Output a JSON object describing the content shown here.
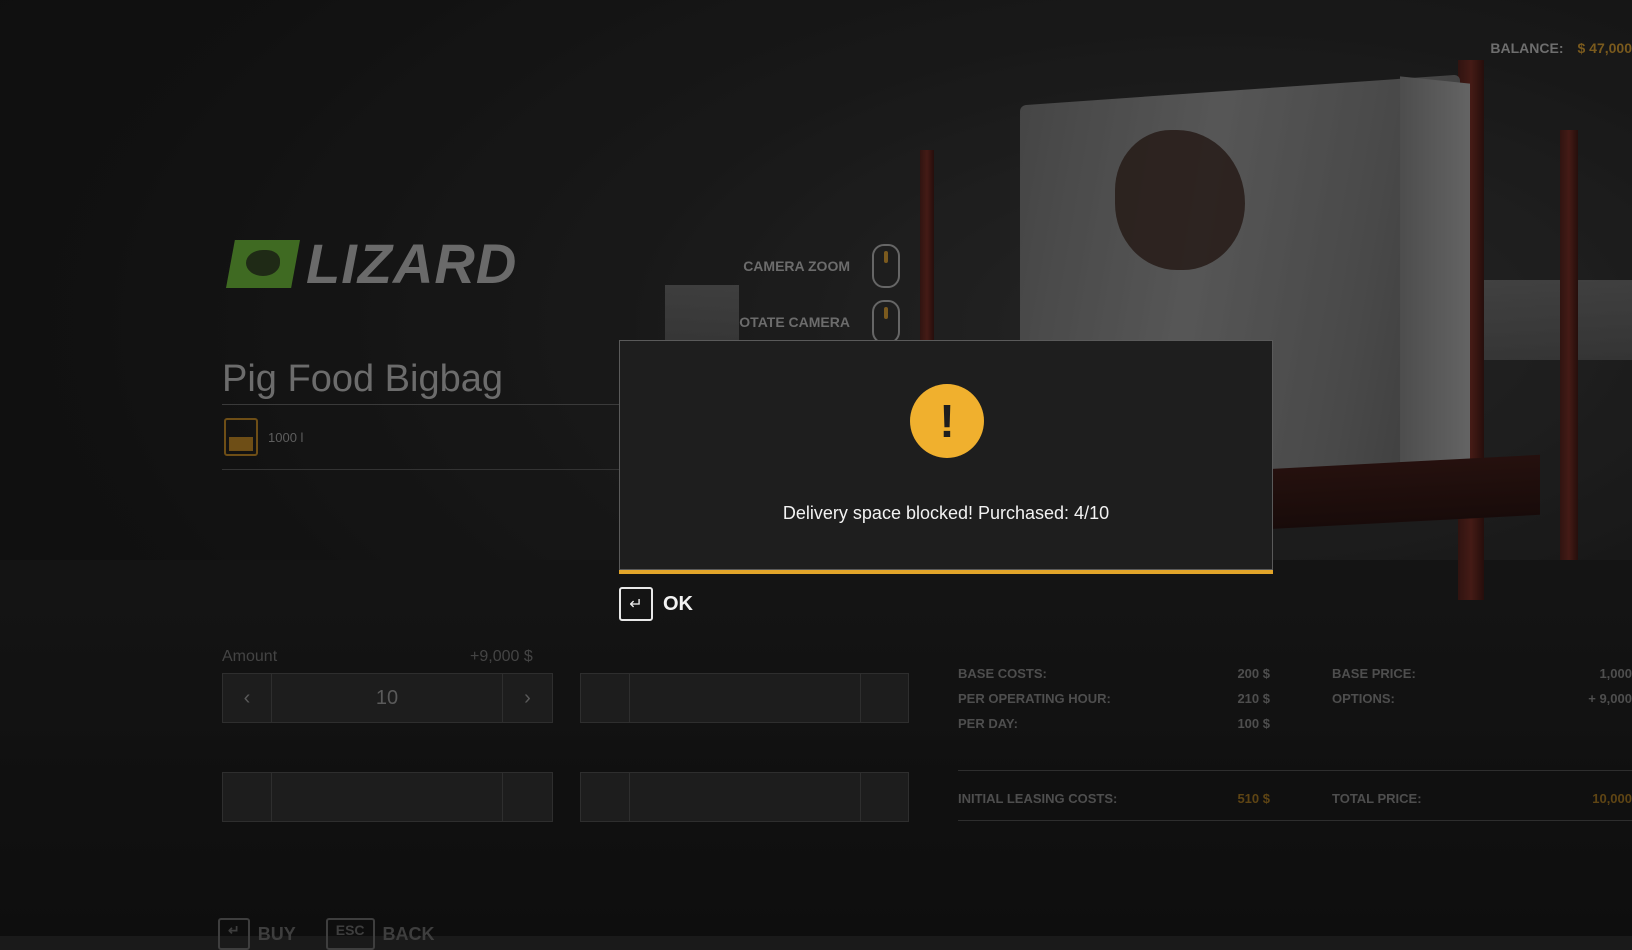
{
  "hud": {
    "balance_label": "BALANCE:",
    "balance_value": "$ 47,000"
  },
  "brand": {
    "name": "LIZARD"
  },
  "controls": [
    {
      "label": "CAMERA ZOOM",
      "icon": "mouse-wheel-icon"
    },
    {
      "label": "OTATE CAMERA",
      "icon": "mouse-right-icon"
    }
  ],
  "product": {
    "title": "Pig Food Bigbag",
    "capacity": "1000 l"
  },
  "amount": {
    "label": "Amount",
    "price": "+9,000 $",
    "value": "10",
    "prev": "‹",
    "next": "›"
  },
  "costs": {
    "base_costs_label": "BASE COSTS:",
    "base_costs": "200 $",
    "per_hour_label": "PER OPERATING HOUR:",
    "per_hour": "210 $",
    "per_day_label": "PER DAY:",
    "per_day": "100 $",
    "base_price_label": "BASE PRICE:",
    "base_price": "1,000",
    "options_label": "OPTIONS:",
    "options": "+ 9,000",
    "initial_leasing_label": "INITIAL LEASING COSTS:",
    "initial_leasing": "510 $",
    "total_price_label": "TOTAL PRICE:",
    "total_price": "10,000"
  },
  "bottom": {
    "buy_key": "↵",
    "buy_label": "BUY",
    "back_key": "ESC",
    "back_label": "BACK"
  },
  "dialog": {
    "icon": "!",
    "message": "Delivery space blocked! Purchased: 4/10",
    "ok_key": "↵",
    "ok_label": "OK",
    "accent": "#f0b02e"
  }
}
